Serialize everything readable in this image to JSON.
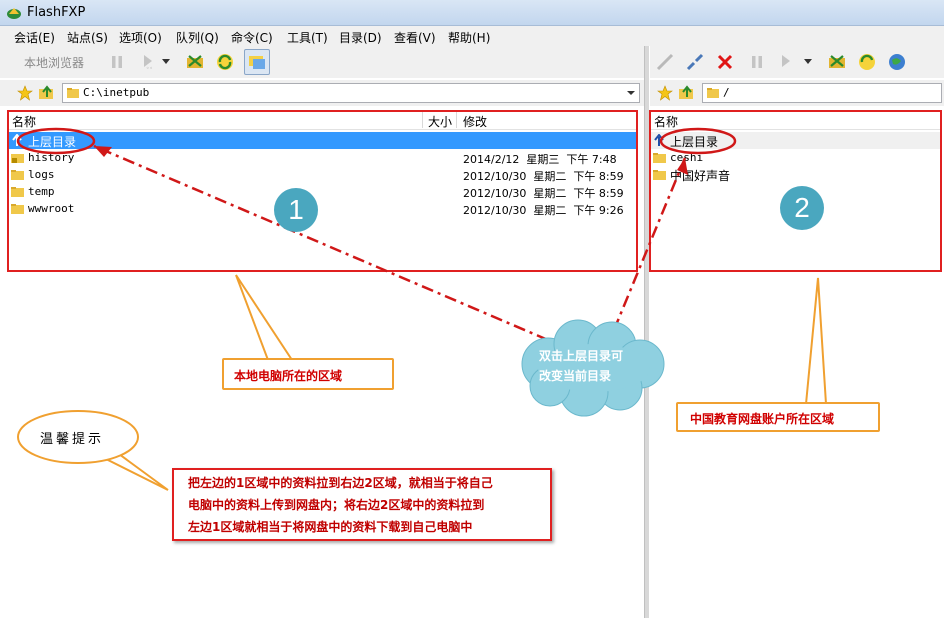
{
  "window": {
    "title": "FlashFXP"
  },
  "menu": [
    "会话(E)",
    "站点(S)",
    "选项(O)",
    "队列(Q)",
    "命令(C)",
    "工具(T)",
    "目录(D)",
    "查看(V)",
    "帮助(H)"
  ],
  "left_toolbar": {
    "label": "本地浏览器"
  },
  "left_path": "C:\\inetpub",
  "right_path": "/",
  "left_list": {
    "headers": {
      "name": "名称",
      "size": "大小",
      "modified": "修改"
    },
    "rows": [
      {
        "name": "上层目录",
        "date": ""
      },
      {
        "name": "history",
        "date": "2014/2/12  星期三  下午 7:48"
      },
      {
        "name": "logs",
        "date": "2012/10/30  星期二  下午 8:59"
      },
      {
        "name": "temp",
        "date": "2012/10/30  星期二  下午 8:59"
      },
      {
        "name": "wwwroot",
        "date": "2012/10/30  星期二  下午 9:26"
      }
    ]
  },
  "right_list": {
    "headers": {
      "name": "名称"
    },
    "rows": [
      {
        "name": "上层目录"
      },
      {
        "name": "ceshi"
      },
      {
        "name": "中国好声音"
      }
    ]
  },
  "annotations": {
    "badge_1": "1",
    "badge_2": "2",
    "local_area": "本地电脑所在的区域",
    "remote_area": "中国教育网盘账户所在区域",
    "cloud_line1": "双击上层目录可",
    "cloud_line2": "改变当前目录",
    "tip_title": "温馨提示",
    "tip_line1": "把左边的1区域中的资料拉到右边2区域，就相当于将自己",
    "tip_line2": "电脑中的资料上传到网盘内；将右边2区域中的资料拉到",
    "tip_line3": "左边1区域就相当于将网盘中的资料下载到自己电脑中"
  },
  "colors": {
    "selection": "#3399ff",
    "annotation_red": "#e02020",
    "callout_orange": "#f0a030",
    "badge": "#4aa7bf",
    "cloud": "#8fd0e0"
  }
}
